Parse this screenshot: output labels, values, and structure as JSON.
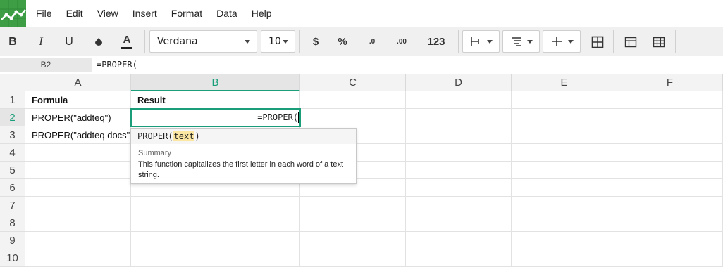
{
  "menu": [
    "File",
    "Edit",
    "View",
    "Insert",
    "Format",
    "Data",
    "Help"
  ],
  "toolbar": {
    "bold_label": "B",
    "italic_label": "I",
    "underline_label": "U",
    "text_color_label": "A",
    "font_family": "Verdana",
    "font_size": "10",
    "currency_label": "$",
    "percent_label": "%",
    "decrease_decimals_label": ".0",
    "increase_decimals_label": ".00",
    "number_format_label": "123"
  },
  "formula_bar": {
    "cell_ref": "B2",
    "content": "=PROPER("
  },
  "columns": [
    "A",
    "B",
    "C",
    "D",
    "E",
    "F"
  ],
  "rows": [
    "1",
    "2",
    "3",
    "4",
    "5",
    "6",
    "7",
    "8",
    "9",
    "10"
  ],
  "cells": {
    "A1": "Formula",
    "B1": "Result",
    "A2": "PROPER(\"addteq\")",
    "A3": "PROPER(\"addteq docs\")"
  },
  "active_cell": {
    "ref": "B2",
    "editing_text": "=PROPER("
  },
  "tooltip": {
    "fn_name": "PROPER(",
    "arg": "text",
    "close_paren": ")",
    "summary_label": "Summary",
    "description": "This function capitalizes the first letter in each word of a text string."
  },
  "colors": {
    "accent": "#1a9e7a",
    "logo_bg": "#3d9e46",
    "arg_highlight": "#fbe6a2"
  }
}
